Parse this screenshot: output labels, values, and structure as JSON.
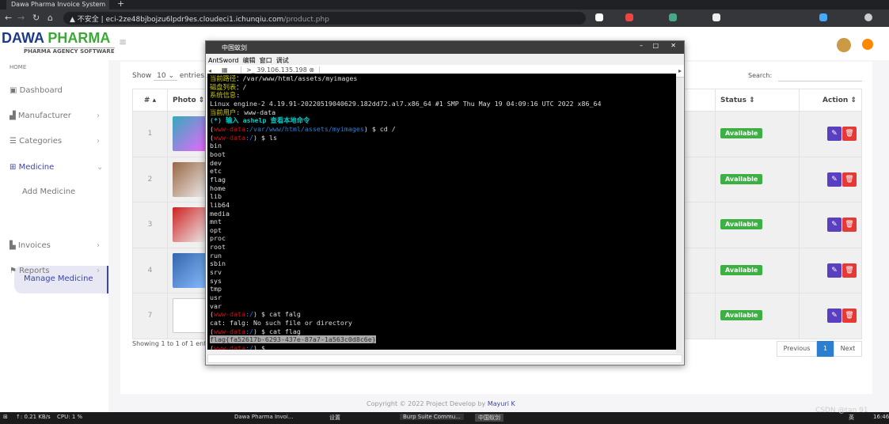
{
  "browser": {
    "tab_title": "Dawa Pharma Invoice System",
    "url_insecure": "不安全",
    "url_host": "eci-2ze48bjbojzu6lpdr9es.cloudeci1.ichunqiu.com",
    "url_path": "/product.php"
  },
  "logo": {
    "title_a": "DAWA",
    "title_b": "PHARMA",
    "subtitle": "PHARMA AGENCY SOFTWARE"
  },
  "sidebar": {
    "home": "HOME",
    "items": [
      {
        "label": "Dashboard",
        "icon": "dashboard-icon"
      },
      {
        "label": "Manufacturer",
        "icon": "factory-icon"
      },
      {
        "label": "Categories",
        "icon": "list-icon"
      },
      {
        "label": "Medicine",
        "icon": "medkit-icon"
      },
      {
        "label": "Add Medicine"
      },
      {
        "label": "Manage Medicine"
      },
      {
        "label": "Invoices",
        "icon": "file-icon"
      },
      {
        "label": "Reports",
        "icon": "flag-icon"
      }
    ]
  },
  "table": {
    "show": "Show",
    "entries_value": "10",
    "entries": "entries",
    "search_label": "Search:",
    "headers": [
      "#",
      "Photo",
      "Status",
      "Action"
    ],
    "rows": [
      {
        "n": "1",
        "status": "Available"
      },
      {
        "n": "2",
        "status": "Available"
      },
      {
        "n": "3",
        "status": "Available"
      },
      {
        "n": "4",
        "status": "Available"
      },
      {
        "n": "7",
        "status": "Available"
      }
    ],
    "info": "Showing 1 to 1 of 1 entries",
    "prev": "Previous",
    "page": "1",
    "next": "Next"
  },
  "footer": {
    "text": "Copyright © 2022 Project Develop by ",
    "author": "Mayuri K"
  },
  "antsword": {
    "title": "中国蚁剑",
    "menu": [
      "AntSword",
      "编辑",
      "窗口",
      "调试"
    ],
    "tab": ">_ 39.106.135.198",
    "lines": [
      [
        [
          "y",
          "当前路径"
        ],
        [
          "",
          "：/var/www/html/assets/myimages"
        ]
      ],
      [
        [
          "y",
          "磁盘列表"
        ],
        [
          "",
          "：/"
        ]
      ],
      [
        [
          "y",
          "系统信息"
        ],
        [
          "",
          ":"
        ]
      ],
      [
        [
          "",
          "Linux engine-2 4.19.91-20220519040629.182dd72.al7.x86_64 #1 SMP Thu May 19 04:09:16 UTC 2022 x86_64"
        ]
      ],
      [
        [
          "y",
          "当前用户"
        ],
        [
          "",
          ": www-data"
        ]
      ],
      [
        [
          "c",
          "(*) 输入 ashelp 查看本地命令"
        ]
      ],
      [
        [
          "",
          "("
        ],
        [
          "r",
          "www-data"
        ],
        [
          "b",
          ":/var/www/html/assets/myimages"
        ],
        [
          "",
          ") $ cd /"
        ]
      ],
      [
        [
          "",
          "("
        ],
        [
          "r",
          "www-data"
        ],
        [
          "b",
          ":/"
        ],
        [
          "",
          ") $ ls"
        ]
      ],
      [
        [
          "",
          "bin"
        ]
      ],
      [
        [
          "",
          "boot"
        ]
      ],
      [
        [
          "",
          "dev"
        ]
      ],
      [
        [
          "",
          "etc"
        ]
      ],
      [
        [
          "",
          "flag"
        ]
      ],
      [
        [
          "",
          "home"
        ]
      ],
      [
        [
          "",
          "lib"
        ]
      ],
      [
        [
          "",
          "lib64"
        ]
      ],
      [
        [
          "",
          "media"
        ]
      ],
      [
        [
          "",
          "mnt"
        ]
      ],
      [
        [
          "",
          "opt"
        ]
      ],
      [
        [
          "",
          "proc"
        ]
      ],
      [
        [
          "",
          "root"
        ]
      ],
      [
        [
          "",
          "run"
        ]
      ],
      [
        [
          "",
          "sbin"
        ]
      ],
      [
        [
          "",
          "srv"
        ]
      ],
      [
        [
          "",
          "sys"
        ]
      ],
      [
        [
          "",
          "tmp"
        ]
      ],
      [
        [
          "",
          "usr"
        ]
      ],
      [
        [
          "",
          "var"
        ]
      ],
      [
        [
          "",
          "("
        ],
        [
          "r",
          "www-data"
        ],
        [
          "b",
          ":/"
        ],
        [
          "",
          ") $ cat falg"
        ]
      ],
      [
        [
          "",
          "cat: falg: No such file or directory"
        ]
      ],
      [
        [
          "",
          "("
        ],
        [
          "r",
          "www-data"
        ],
        [
          "b",
          ":/"
        ],
        [
          "",
          ") $ cat flag"
        ]
      ],
      [
        [
          "sel",
          "flag{fa52617b-6293-437e-87a7-1a563c0d8c6e}"
        ]
      ],
      [
        [
          "",
          "("
        ],
        [
          "r",
          "www-data"
        ],
        [
          "b",
          ":/"
        ],
        [
          "",
          ") $"
        ]
      ]
    ]
  },
  "taskbar": {
    "net_up": "↑: 0.21 KB/s",
    "cpu": "CPU: 1 %",
    "items": [
      "Dawa Pharma Invoi...",
      "设置",
      "Burp Suite Commu...",
      "中国蚁剑"
    ],
    "watermark": "CSDN @tan 91",
    "ime": "英",
    "time": "16:46"
  }
}
